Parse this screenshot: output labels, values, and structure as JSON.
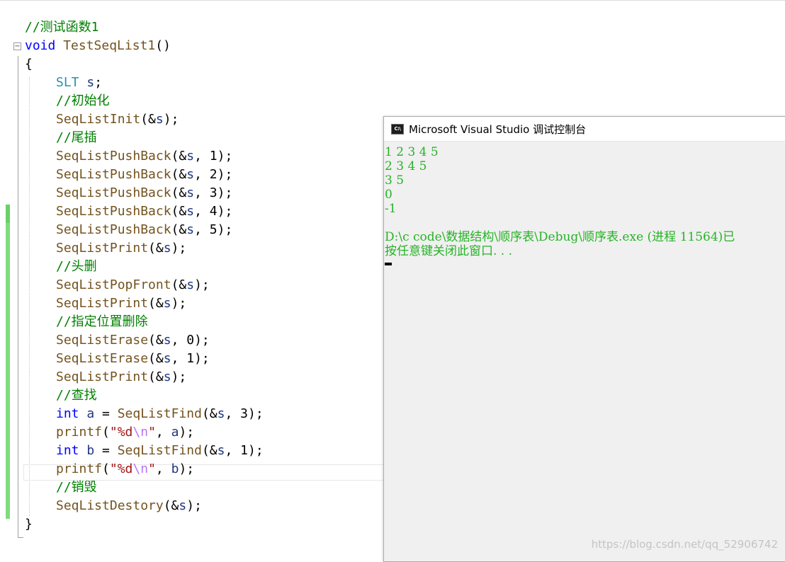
{
  "console": {
    "title": "Microsoft Visual Studio 调试控制台",
    "icon": "console-app-icon",
    "lines": [
      "1 2 3 4 5",
      "2 3 4 5",
      "3 5",
      "0",
      "-1",
      "",
      "D:\\c code\\数据结构\\顺序表\\Debug\\顺序表.exe (进程 11564)已",
      "按任意键关闭此窗口. . ."
    ]
  },
  "watermark": "https://blog.csdn.net/qq_52906742",
  "colors": {
    "comment": "#008000",
    "keyword": "#0000ff",
    "type": "#2b91af",
    "function": "#74531f",
    "variable": "#1f377f",
    "string": "#a31515",
    "escape": "#b776fb",
    "console_text": "#26b326",
    "change_bar": "#6ad168"
  },
  "code": {
    "lines": [
      [
        {
          "t": "cm",
          "v": "//测试函数1"
        }
      ],
      [
        {
          "t": "kw",
          "v": "void"
        },
        {
          "t": "tx",
          "v": " "
        },
        {
          "t": "fn",
          "v": "TestSeqList1"
        },
        {
          "t": "tx",
          "v": "()"
        }
      ],
      [
        {
          "t": "tx",
          "v": "{"
        }
      ],
      [
        {
          "t": "ind"
        },
        {
          "t": "ty",
          "v": "SLT"
        },
        {
          "t": "tx",
          "v": " "
        },
        {
          "t": "vr",
          "v": "s"
        },
        {
          "t": "tx",
          "v": ";"
        }
      ],
      [
        {
          "t": "ind"
        },
        {
          "t": "cm",
          "v": "//初始化"
        }
      ],
      [
        {
          "t": "ind"
        },
        {
          "t": "fn",
          "v": "SeqListInit"
        },
        {
          "t": "tx",
          "v": "(&"
        },
        {
          "t": "vr",
          "v": "s"
        },
        {
          "t": "tx",
          "v": ");"
        }
      ],
      [
        {
          "t": "ind"
        },
        {
          "t": "cm",
          "v": "//尾插"
        }
      ],
      [
        {
          "t": "ind"
        },
        {
          "t": "fn",
          "v": "SeqListPushBack"
        },
        {
          "t": "tx",
          "v": "(&"
        },
        {
          "t": "vr",
          "v": "s"
        },
        {
          "t": "tx",
          "v": ", 1);"
        }
      ],
      [
        {
          "t": "ind"
        },
        {
          "t": "fn",
          "v": "SeqListPushBack"
        },
        {
          "t": "tx",
          "v": "(&"
        },
        {
          "t": "vr",
          "v": "s"
        },
        {
          "t": "tx",
          "v": ", 2);"
        }
      ],
      [
        {
          "t": "ind"
        },
        {
          "t": "fn",
          "v": "SeqListPushBack"
        },
        {
          "t": "tx",
          "v": "(&"
        },
        {
          "t": "vr",
          "v": "s"
        },
        {
          "t": "tx",
          "v": ", 3);"
        }
      ],
      [
        {
          "t": "ind"
        },
        {
          "t": "fn",
          "v": "SeqListPushBack"
        },
        {
          "t": "tx",
          "v": "(&"
        },
        {
          "t": "vr",
          "v": "s"
        },
        {
          "t": "tx",
          "v": ", 4);"
        }
      ],
      [
        {
          "t": "ind"
        },
        {
          "t": "fn",
          "v": "SeqListPushBack"
        },
        {
          "t": "tx",
          "v": "(&"
        },
        {
          "t": "vr",
          "v": "s"
        },
        {
          "t": "tx",
          "v": ", 5);"
        }
      ],
      [
        {
          "t": "ind"
        },
        {
          "t": "fn",
          "v": "SeqListPrint"
        },
        {
          "t": "tx",
          "v": "(&"
        },
        {
          "t": "vr",
          "v": "s"
        },
        {
          "t": "tx",
          "v": ");"
        }
      ],
      [
        {
          "t": "ind"
        },
        {
          "t": "cm",
          "v": "//头删"
        }
      ],
      [
        {
          "t": "ind"
        },
        {
          "t": "fn",
          "v": "SeqListPopFront"
        },
        {
          "t": "tx",
          "v": "(&"
        },
        {
          "t": "vr",
          "v": "s"
        },
        {
          "t": "tx",
          "v": ");"
        }
      ],
      [
        {
          "t": "ind"
        },
        {
          "t": "fn",
          "v": "SeqListPrint"
        },
        {
          "t": "tx",
          "v": "(&"
        },
        {
          "t": "vr",
          "v": "s"
        },
        {
          "t": "tx",
          "v": ");"
        }
      ],
      [
        {
          "t": "ind"
        },
        {
          "t": "cm",
          "v": "//指定位置删除"
        }
      ],
      [
        {
          "t": "ind"
        },
        {
          "t": "fn",
          "v": "SeqListErase"
        },
        {
          "t": "tx",
          "v": "(&"
        },
        {
          "t": "vr",
          "v": "s"
        },
        {
          "t": "tx",
          "v": ", 0);"
        }
      ],
      [
        {
          "t": "ind"
        },
        {
          "t": "fn",
          "v": "SeqListErase"
        },
        {
          "t": "tx",
          "v": "(&"
        },
        {
          "t": "vr",
          "v": "s"
        },
        {
          "t": "tx",
          "v": ", 1);"
        }
      ],
      [
        {
          "t": "ind"
        },
        {
          "t": "fn",
          "v": "SeqListPrint"
        },
        {
          "t": "tx",
          "v": "(&"
        },
        {
          "t": "vr",
          "v": "s"
        },
        {
          "t": "tx",
          "v": ");"
        }
      ],
      [
        {
          "t": "ind"
        },
        {
          "t": "cm",
          "v": "//查找"
        }
      ],
      [
        {
          "t": "ind"
        },
        {
          "t": "kw",
          "v": "int"
        },
        {
          "t": "tx",
          "v": " "
        },
        {
          "t": "vr",
          "v": "a"
        },
        {
          "t": "tx",
          "v": " = "
        },
        {
          "t": "fn",
          "v": "SeqListFind"
        },
        {
          "t": "tx",
          "v": "(&"
        },
        {
          "t": "vr",
          "v": "s"
        },
        {
          "t": "tx",
          "v": ", 3);"
        }
      ],
      [
        {
          "t": "ind"
        },
        {
          "t": "fn",
          "v": "printf"
        },
        {
          "t": "tx",
          "v": "("
        },
        {
          "t": "st",
          "v": "\"%d"
        },
        {
          "t": "es",
          "v": "\\n"
        },
        {
          "t": "st",
          "v": "\""
        },
        {
          "t": "tx",
          "v": ", "
        },
        {
          "t": "vr",
          "v": "a"
        },
        {
          "t": "tx",
          "v": ");"
        }
      ],
      [
        {
          "t": "ind"
        },
        {
          "t": "kw",
          "v": "int"
        },
        {
          "t": "tx",
          "v": " "
        },
        {
          "t": "vr",
          "v": "b"
        },
        {
          "t": "tx",
          "v": " = "
        },
        {
          "t": "fn",
          "v": "SeqListFind"
        },
        {
          "t": "tx",
          "v": "(&"
        },
        {
          "t": "vr",
          "v": "s"
        },
        {
          "t": "tx",
          "v": ", 1);"
        }
      ],
      [
        {
          "t": "ind"
        },
        {
          "t": "fn",
          "v": "printf"
        },
        {
          "t": "tx",
          "v": "("
        },
        {
          "t": "st",
          "v": "\"%d"
        },
        {
          "t": "es",
          "v": "\\n"
        },
        {
          "t": "st",
          "v": "\""
        },
        {
          "t": "tx",
          "v": ", "
        },
        {
          "t": "vr",
          "v": "b"
        },
        {
          "t": "tx",
          "v": ");"
        }
      ],
      [
        {
          "t": "ind"
        },
        {
          "t": "cm",
          "v": "//销毁"
        }
      ],
      [
        {
          "t": "ind"
        },
        {
          "t": "fn",
          "v": "SeqListDestory"
        },
        {
          "t": "tx",
          "v": "(&"
        },
        {
          "t": "vr",
          "v": "s"
        },
        {
          "t": "tx",
          "v": ");"
        }
      ],
      [
        {
          "t": "tx",
          "v": "}"
        }
      ]
    ]
  }
}
